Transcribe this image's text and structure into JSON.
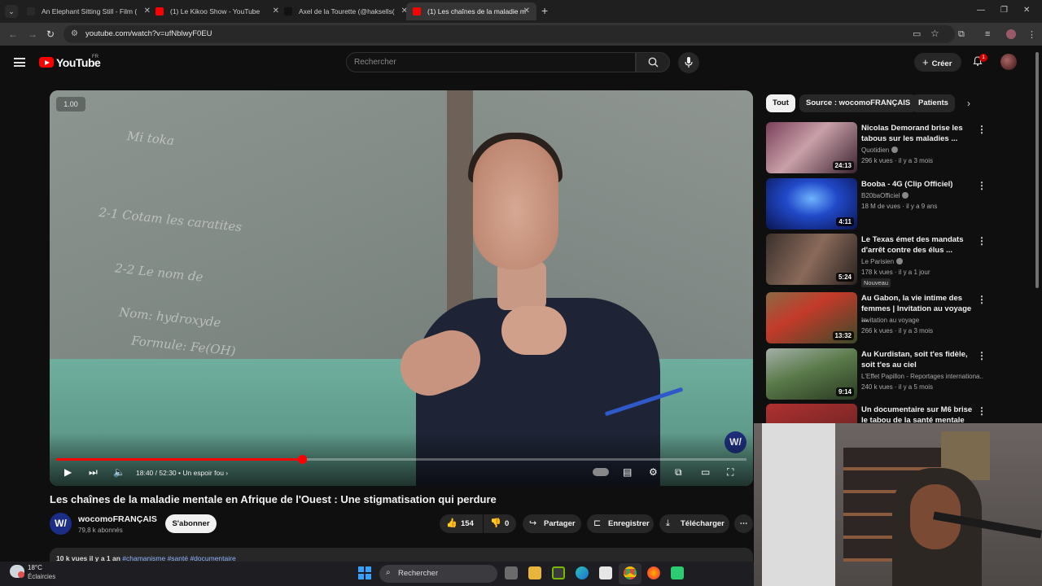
{
  "browser": {
    "tabs": [
      {
        "title": "An Elephant Sitting Still - Film (",
        "active": false,
        "favicon_color": "#2a2a2a"
      },
      {
        "title": "(1) Le Kikoo Show - YouTube",
        "active": false,
        "favicon_color": "#ff0000"
      },
      {
        "title": "Axel de la Tourette (@haksells(",
        "active": false,
        "favicon_color": "#111111"
      },
      {
        "title": "(1) Les chaînes de la maladie m",
        "active": true,
        "favicon_color": "#ff0000"
      }
    ],
    "url": "youtube.com/watch?v=ufNblwyF0EU"
  },
  "youtube": {
    "brand": "YouTube",
    "country": "FR",
    "search_placeholder": "Rechercher",
    "create_label": "Créer",
    "notifications": "1"
  },
  "video": {
    "speed_badge": "1.00",
    "time_current": "18:40",
    "time_total": "52:30",
    "chapter": "Un espoir fou",
    "progress": 0.356,
    "watermark": "W/",
    "title": "Les chaînes de la maladie mentale en Afrique de l'Ouest : Une stigmatisation qui perdure"
  },
  "channel": {
    "name": "wocomoFRANÇAIS",
    "subscribers": "79,8 k abonnés",
    "avatar_text": "W/",
    "subscribe_label": "S'abonner"
  },
  "actions": {
    "likes": "154",
    "dislikes": "0",
    "share": "Partager",
    "save": "Enregistrer",
    "download": "Télécharger"
  },
  "description": {
    "meta": "10 k vues  il y a 1 an",
    "tags": "#chamanisme #santé #documentaire"
  },
  "chips": [
    {
      "label": "Tout",
      "active": true
    },
    {
      "label": "Source : wocomoFRANÇAIS",
      "active": false
    },
    {
      "label": "Patients",
      "active": false
    }
  ],
  "recommendations": [
    {
      "title": "Nicolas Demorand brise les tabous sur les maladies ...",
      "channel": "Quotidien",
      "verified": true,
      "meta": "296 k vues · il y a 3 mois",
      "duration": "24:13",
      "badge": "",
      "thumb_color": "#6a3a54"
    },
    {
      "title": "Booba - 4G (Clip Officiel)",
      "channel": "B20baOfficiel",
      "verified": true,
      "meta": "18 M de vues · il y a 9 ans",
      "duration": "4:11",
      "badge": "",
      "thumb_color": "#1a3fb8"
    },
    {
      "title": "Le Texas émet des mandats d'arrêt contre des élus ...",
      "channel": "Le Parisien",
      "verified": true,
      "meta": "178 k vues · il y a 1 jour",
      "duration": "5:24",
      "badge": "Nouveau",
      "thumb_color": "#5b4a45"
    },
    {
      "title": "Au Gabon, la vie intime des femmes | Invitation au voyage ...",
      "channel": "Invitation au voyage",
      "verified": false,
      "meta": "266 k vues · il y a 3 mois",
      "duration": "13:32",
      "badge": "",
      "thumb_color": "#7a5a3a"
    },
    {
      "title": "Au Kurdistan, soit t'es fidèle, soit t'es au ciel",
      "channel": "L'Effet Papillon - Reportages internationa...",
      "verified": false,
      "meta": "240 k vues · il y a 5 mois",
      "duration": "9:14",
      "badge": "",
      "thumb_color": "#4d6a45"
    },
    {
      "title": "Un documentaire sur M6 brise le tabou de la santé mentale",
      "channel": "",
      "verified": false,
      "meta": "",
      "duration": "",
      "badge": "",
      "thumb_color": "#8a2a2a"
    }
  ],
  "taskbar": {
    "temperature": "18°C",
    "condition": "Éclaircies",
    "search_label": "Rechercher"
  },
  "colors": {
    "accent_red": "#ff0000",
    "background": "#0f0f0f",
    "chip_bg": "#272727"
  }
}
